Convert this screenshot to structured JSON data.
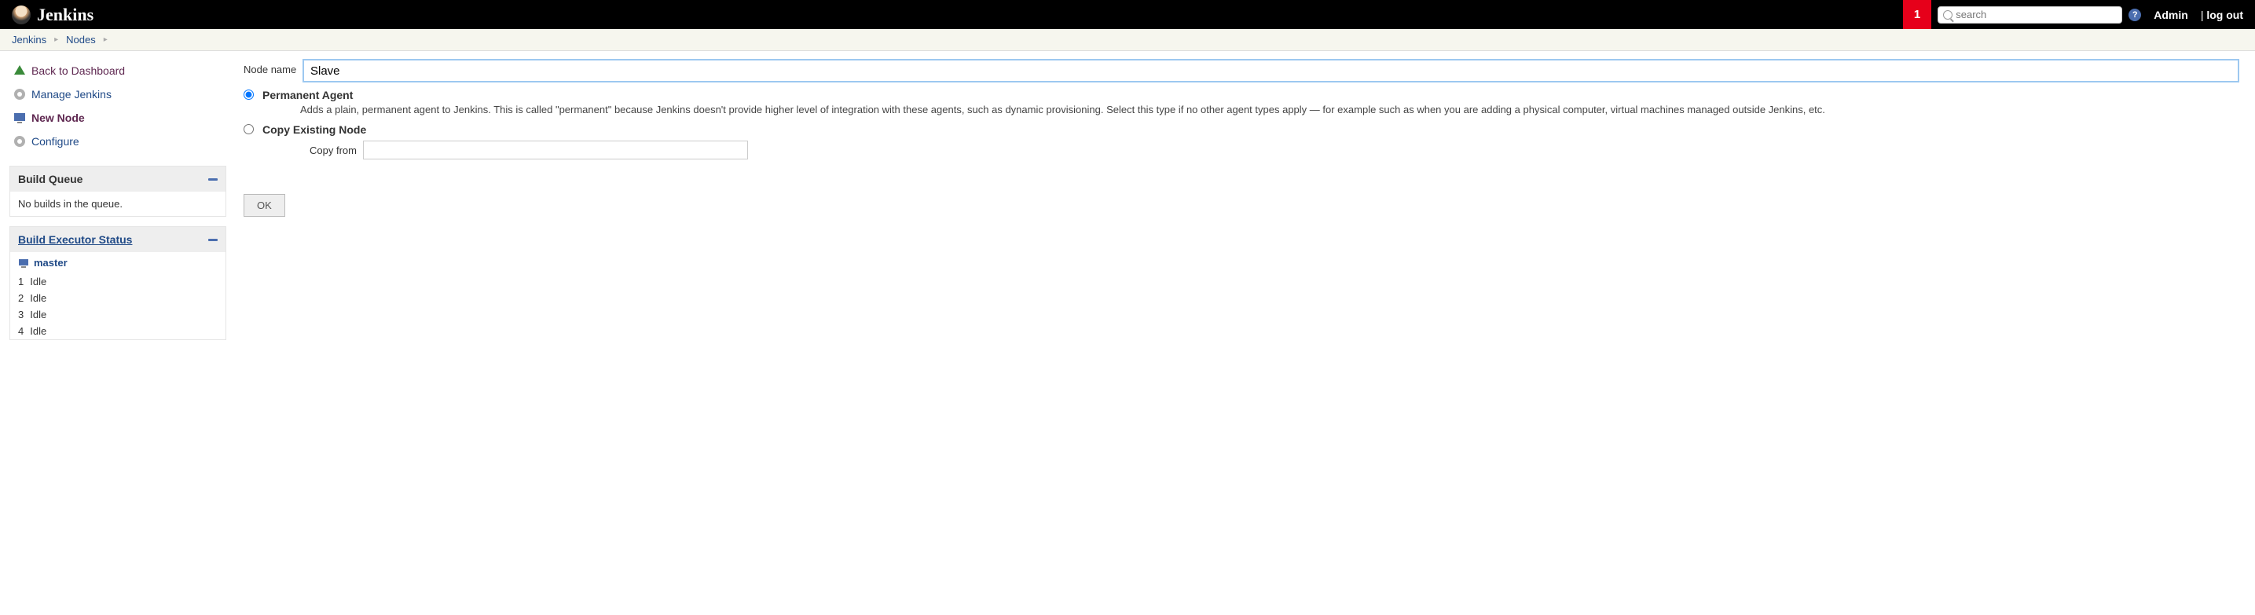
{
  "header": {
    "app_name": "Jenkins",
    "notification_count": "1",
    "search_placeholder": "search",
    "user_label": "Admin",
    "logout_label": "log out"
  },
  "breadcrumb": {
    "items": [
      "Jenkins",
      "Nodes"
    ]
  },
  "sidebar": {
    "nav": [
      {
        "label": "Back to Dashboard"
      },
      {
        "label": "Manage Jenkins"
      },
      {
        "label": "New Node"
      },
      {
        "label": "Configure"
      }
    ],
    "build_queue": {
      "title": "Build Queue",
      "empty_text": "No builds in the queue."
    },
    "executor_status": {
      "title": "Build Executor Status",
      "master_label": "master",
      "rows": [
        {
          "num": "1",
          "state": "Idle"
        },
        {
          "num": "2",
          "state": "Idle"
        },
        {
          "num": "3",
          "state": "Idle"
        },
        {
          "num": "4",
          "state": "Idle"
        }
      ]
    }
  },
  "form": {
    "node_name_label": "Node name",
    "node_name_value": "Slave",
    "permanent_agent": {
      "title": "Permanent Agent",
      "description": "Adds a plain, permanent agent to Jenkins. This is called \"permanent\" because Jenkins doesn't provide higher level of integration with these agents, such as dynamic provisioning. Select this type if no other agent types apply — for example such as when you are adding a physical computer, virtual machines managed outside Jenkins, etc."
    },
    "copy_existing": {
      "title": "Copy Existing Node",
      "copy_from_label": "Copy from",
      "copy_from_value": ""
    },
    "ok_label": "OK"
  }
}
